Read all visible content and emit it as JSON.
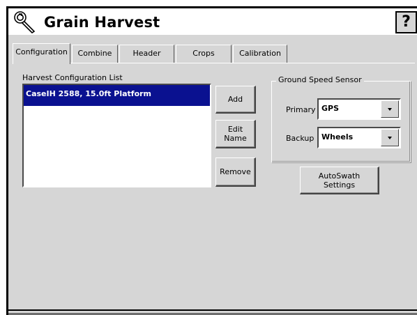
{
  "app": {
    "title": "Grain Harvest",
    "help_label": "?"
  },
  "tabs": [
    {
      "label": "Configuration",
      "active": true
    },
    {
      "label": "Combine",
      "active": false
    },
    {
      "label": "Header",
      "active": false
    },
    {
      "label": "Crops",
      "active": false
    },
    {
      "label": "Calibration",
      "active": false
    }
  ],
  "harvest_list": {
    "label": "Harvest Configuration List",
    "items": [
      {
        "name": "CaseIH 2588, 15.0ft Platform",
        "selected": true
      }
    ]
  },
  "buttons": {
    "add": "Add",
    "edit_name_line1": "Edit",
    "edit_name_line2": "Name",
    "remove": "Remove",
    "autoswath_line1": "AutoSwath",
    "autoswath_line2": "Settings"
  },
  "ground_speed": {
    "title": "Ground Speed Sensor",
    "primary_label": "Primary",
    "primary_value": "GPS",
    "backup_label": "Backup",
    "backup_value": "Wheels"
  },
  "colors": {
    "panel": "#d6d6d6",
    "selection": "#0a1190"
  }
}
